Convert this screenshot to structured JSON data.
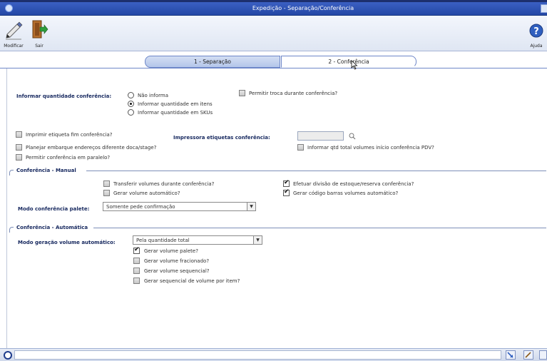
{
  "window": {
    "title": "Expedição - Separação/Conferência"
  },
  "toolbar": {
    "modify_label": "Modificar",
    "exit_label": "Sair",
    "help_label": "Ajuda"
  },
  "tabs": [
    {
      "label": "1 - Separação",
      "active": false
    },
    {
      "label": "2 - Conferência",
      "active": true
    }
  ],
  "form": {
    "qty_label": "Informar quantidade conferência:",
    "qty_options": [
      {
        "label": "Não informa",
        "checked": false
      },
      {
        "label": "Informar quantidade em itens",
        "checked": true
      },
      {
        "label": "Informar quantidade em SKUs",
        "checked": false
      }
    ],
    "allow_swap": {
      "label": "Permitir troca durante conferência?",
      "checked": false
    },
    "print_label": {
      "label": "Imprimir etiqueta fim conferência?",
      "checked": false
    },
    "plan_shipment": {
      "label": "Planejar embarque endereços diferente doca/stage?",
      "checked": false
    },
    "parallel": {
      "label": "Permitir conferência em paralelo?",
      "checked": false
    },
    "printer_label": "Impressora etiquetas conferência:",
    "printer_value": "",
    "total_volumes": {
      "label": "Informar qtd total volumes início conferência PDV?",
      "checked": false
    }
  },
  "manual": {
    "section_title": "Conferência - Manual",
    "transfer_volumes": {
      "label": "Transferir volumes durante conferência?",
      "checked": false
    },
    "auto_volume": {
      "label": "Gerar volume automático?",
      "checked": false
    },
    "stock_split": {
      "label": "Efetuar divisão de estoque/reserva conferência?",
      "checked": true
    },
    "barcode_auto": {
      "label": "Gerar código barras volumes automático?",
      "checked": true
    },
    "pallet_mode_label": "Modo conferência palete:",
    "pallet_mode_value": "Somente pede confirmação"
  },
  "automatic": {
    "section_title": "Conferência - Automática",
    "mode_label": "Modo geração volume automático:",
    "mode_value": "Pela quantidade total",
    "options": [
      {
        "label": "Gerar volume palete?",
        "checked": true
      },
      {
        "label": "Gerar volume fracionado?",
        "checked": false
      },
      {
        "label": "Gerar volume sequencial?",
        "checked": false
      },
      {
        "label": "Gerar sequencial de volume por item?",
        "checked": false
      }
    ]
  },
  "colors": {
    "titlebar": "#2f55b8",
    "label_blue": "#15275e",
    "tab_border": "#6e87c8"
  }
}
